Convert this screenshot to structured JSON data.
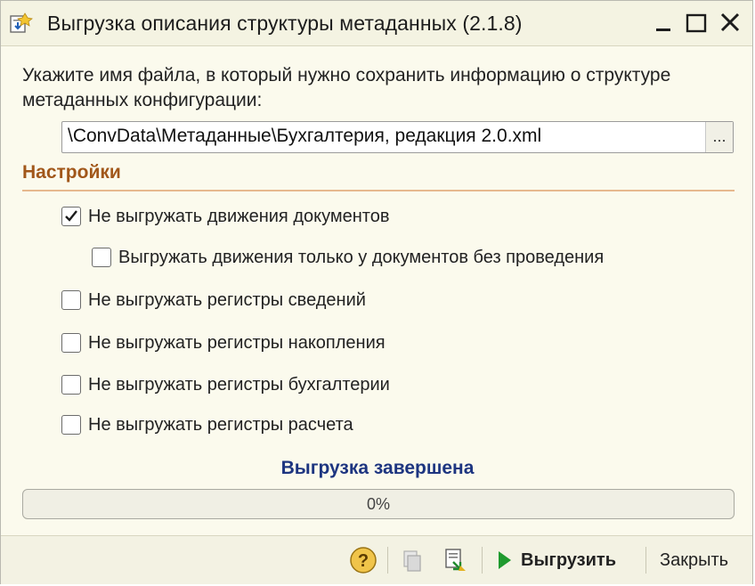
{
  "window": {
    "title": "Выгрузка описания структуры метаданных (2.1.8)"
  },
  "icons": {
    "app": "export-document-icon",
    "minimize": "minimize-icon",
    "maximize": "maximize-icon",
    "close": "close-icon"
  },
  "form": {
    "prompt": "Укажите имя файла, в который нужно сохранить информацию о структуре метаданных конфигурации:",
    "file_path": "\\ConvData\\Метаданные\\Бухгалтерия, редакция 2.0.xml",
    "browse_label": "..."
  },
  "settings": {
    "title": "Настройки",
    "options": [
      {
        "label": "Не выгружать движения документов",
        "checked": true
      },
      {
        "label": "Выгружать движения только у документов без проведения",
        "checked": false
      },
      {
        "label": "Не выгружать регистры сведений",
        "checked": false
      },
      {
        "label": "Не выгружать регистры накопления",
        "checked": false
      },
      {
        "label": "Не выгружать регистры бухгалтерии",
        "checked": false
      },
      {
        "label": "Не выгружать регистры расчета",
        "checked": false
      }
    ]
  },
  "status": {
    "text": "Выгрузка завершена"
  },
  "progress": {
    "text": "0%",
    "value": 0
  },
  "footer": {
    "export_label": "Выгрузить",
    "close_label": "Закрыть"
  },
  "colors": {
    "section_title": "#a1571a",
    "status_text": "#1d3580",
    "window_bg": "#fbfaed"
  }
}
